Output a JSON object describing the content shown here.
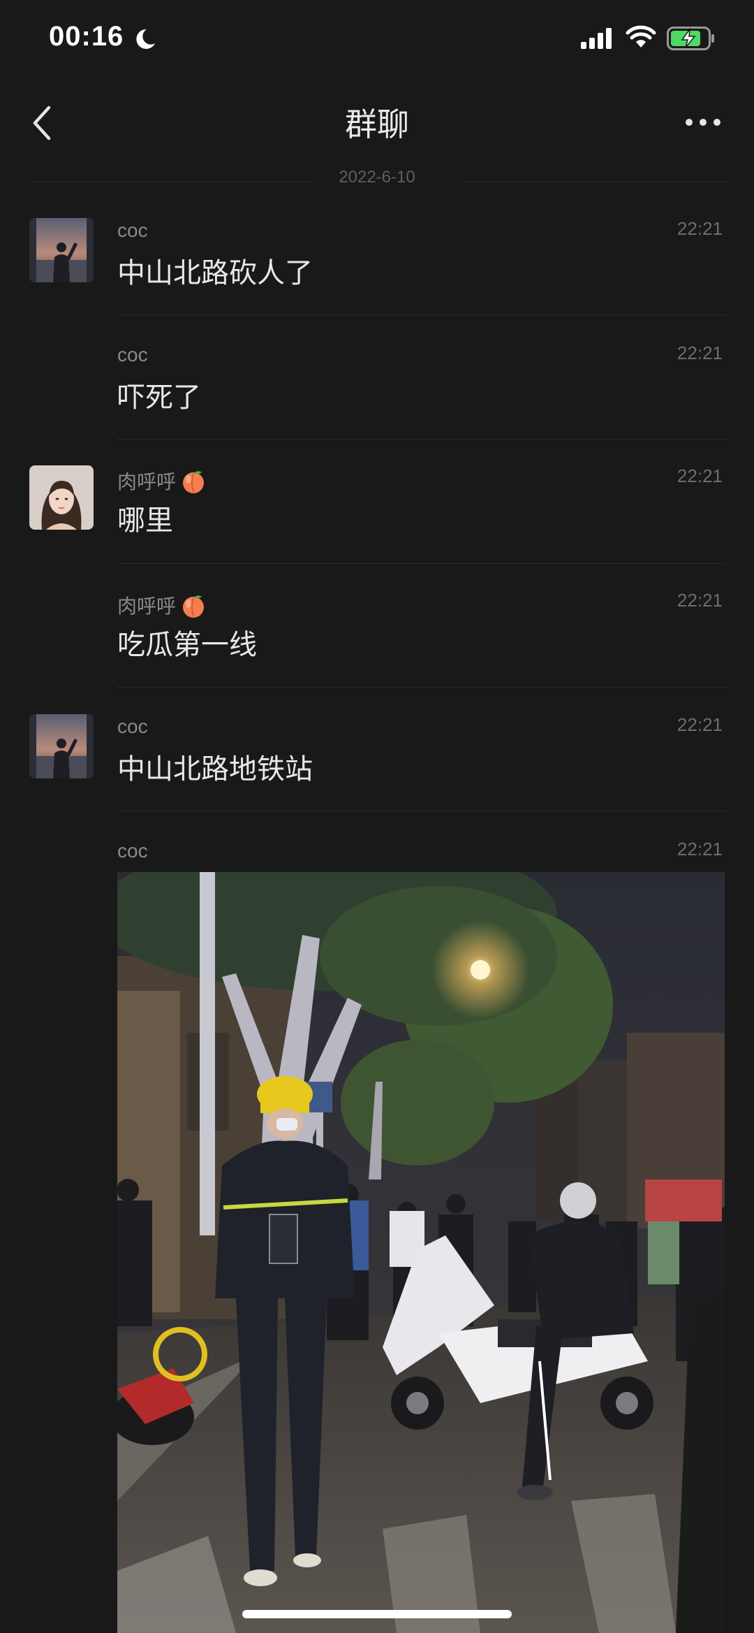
{
  "status_bar": {
    "time": "00:16"
  },
  "nav": {
    "title": "群聊"
  },
  "date_divider": "2022-6-10",
  "messages": [
    {
      "sender": "coc",
      "time": "22:21",
      "text": "中山北路砍人了",
      "avatar": "landscape-photo-avatar"
    },
    {
      "sender": "coc",
      "time": "22:21",
      "text": "吓死了"
    },
    {
      "sender": "肉呼呼",
      "sender_emoji": "peach",
      "time": "22:21",
      "text": "哪里",
      "avatar": "portrait-woman-avatar"
    },
    {
      "sender": "肉呼呼",
      "sender_emoji": "peach",
      "time": "22:21",
      "text": "吃瓜第一线"
    },
    {
      "sender": "coc",
      "time": "22:21",
      "text": "中山北路地铁站",
      "avatar": "landscape-photo-avatar"
    },
    {
      "sender": "coc",
      "time": "22:21",
      "attachment": "street-night-photo"
    }
  ],
  "colors": {
    "background": "#191919",
    "text": "#e8e8e8",
    "secondary": "#8a8a8a",
    "divider": "#2b2b2b",
    "battery": "#4cd964"
  }
}
